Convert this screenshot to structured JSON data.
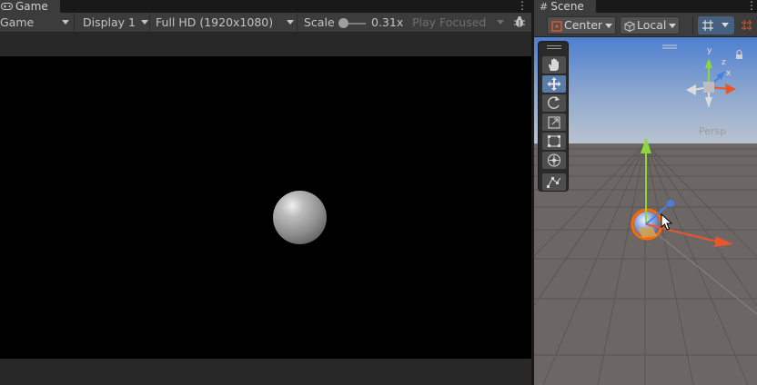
{
  "game": {
    "tab_label": "Game",
    "toolbar": {
      "view_mode": "Game",
      "display": "Display 1",
      "resolution": "Full HD (1920x1080)",
      "scale_label": "Scale",
      "scale_value": "0.31x",
      "play_mode": "Play Focused"
    }
  },
  "scene": {
    "tab_label": "Scene",
    "toolbar": {
      "pivot": "Center",
      "space": "Local"
    },
    "projection": "Persp",
    "gizmo_axes": {
      "y": "y",
      "x": "x",
      "z": "z"
    }
  },
  "icons": {
    "game_tab": "gamepad-icon",
    "scene_tab": "grid-hash-icon",
    "more_menu": "kebab-icon",
    "debug": "bug-icon",
    "pivot": "center-pivot-icon",
    "space": "local-cube-icon",
    "grid_toggle": "grid-snap-icon",
    "tools": [
      "hand-tool-icon",
      "move-tool-icon",
      "rotate-tool-icon",
      "scale-tool-icon",
      "rect-tool-icon",
      "transform-tool-icon",
      "custom-tool-icon"
    ]
  },
  "colors": {
    "x_axis": "#e8562b",
    "y_axis": "#8ed63d",
    "z_axis": "#4a7fe0",
    "selection": "#ff6a00",
    "active_tool": "#5a7aa8"
  }
}
